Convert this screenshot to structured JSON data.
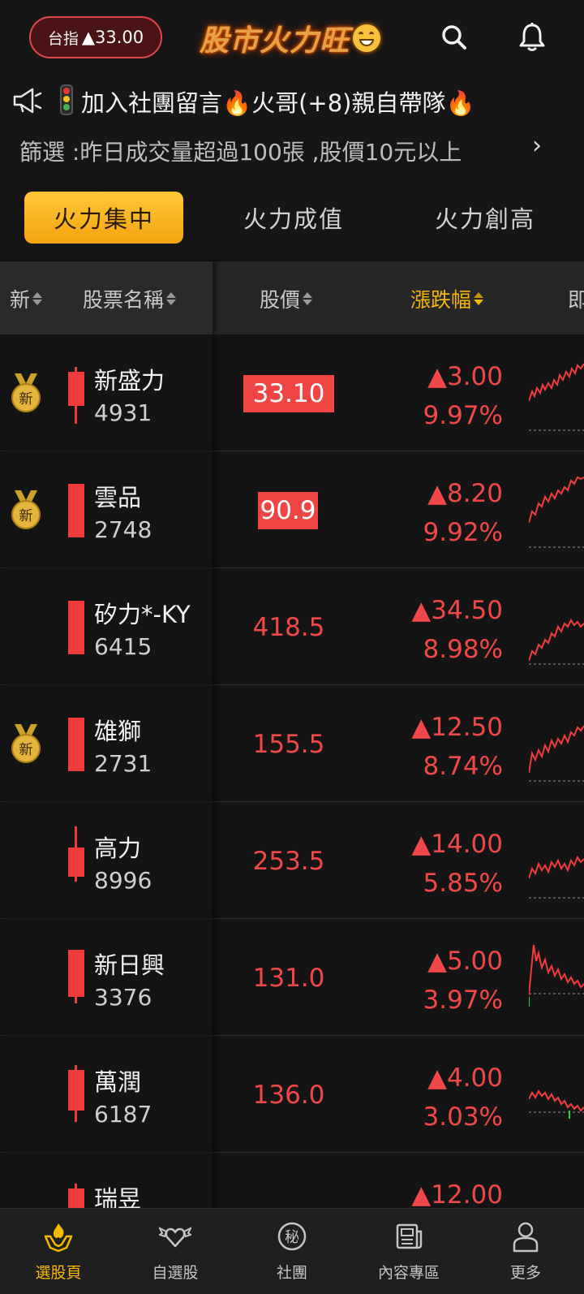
{
  "header": {
    "index_label": "台指",
    "index_value": "▲33.00",
    "logo_text": "股市火力旺",
    "icons": [
      "search-icon",
      "bell-icon"
    ]
  },
  "announcement": {
    "text": "加入社團留言🔥火哥(+8)親自帶隊🔥",
    "icons": [
      "megaphone-icon",
      "traffic-light-icon",
      "close-icon"
    ]
  },
  "filter": {
    "text": "篩選 :昨日成交量超過100張 ,股價10元以上",
    "chevron": "›"
  },
  "tabs": [
    {
      "label": "火力集中",
      "active": true
    },
    {
      "label": "火力成值",
      "active": false
    },
    {
      "label": "火力創高",
      "active": false
    }
  ],
  "columns": {
    "new": "新",
    "name": "股票名稱",
    "price": "股價",
    "change": "漲跌幅",
    "next": "即"
  },
  "medal_label": "新",
  "stocks": [
    {
      "name": "新盛力",
      "code": "4931",
      "price": "33.10",
      "change": "▲3.00",
      "pct": "9.97%",
      "new": true,
      "highlight": true
    },
    {
      "name": "雲品",
      "code": "2748",
      "price": "90.9",
      "change": "▲8.20",
      "pct": "9.92%",
      "new": true,
      "highlight": true
    },
    {
      "name": "矽力*-KY",
      "code": "6415",
      "price": "418.5",
      "change": "▲34.50",
      "pct": "8.98%",
      "new": false,
      "highlight": false
    },
    {
      "name": "雄獅",
      "code": "2731",
      "price": "155.5",
      "change": "▲12.50",
      "pct": "8.74%",
      "new": true,
      "highlight": false
    },
    {
      "name": "高力",
      "code": "8996",
      "price": "253.5",
      "change": "▲14.00",
      "pct": "5.85%",
      "new": false,
      "highlight": false
    },
    {
      "name": "新日興",
      "code": "3376",
      "price": "131.0",
      "change": "▲5.00",
      "pct": "3.97%",
      "new": false,
      "highlight": false
    },
    {
      "name": "萬潤",
      "code": "6187",
      "price": "136.0",
      "change": "▲4.00",
      "pct": "3.03%",
      "new": false,
      "highlight": false
    },
    {
      "name": "瑞昱",
      "code": "",
      "price": "",
      "change": "▲12.00",
      "pct": "",
      "new": false,
      "highlight": false
    }
  ],
  "colors": {
    "up": "#f04848",
    "accent": "#f5b800",
    "background": "#141414"
  },
  "bottom_nav": [
    {
      "label": "選股頁",
      "icon": "fire-hands-icon",
      "active": true
    },
    {
      "label": "自選股",
      "icon": "winged-heart-icon",
      "active": false
    },
    {
      "label": "社團",
      "icon": "secret-badge-icon",
      "active": false,
      "badge": "秘"
    },
    {
      "label": "內容專區",
      "icon": "newspaper-icon",
      "active": false
    },
    {
      "label": "更多",
      "icon": "person-icon",
      "active": false
    }
  ]
}
